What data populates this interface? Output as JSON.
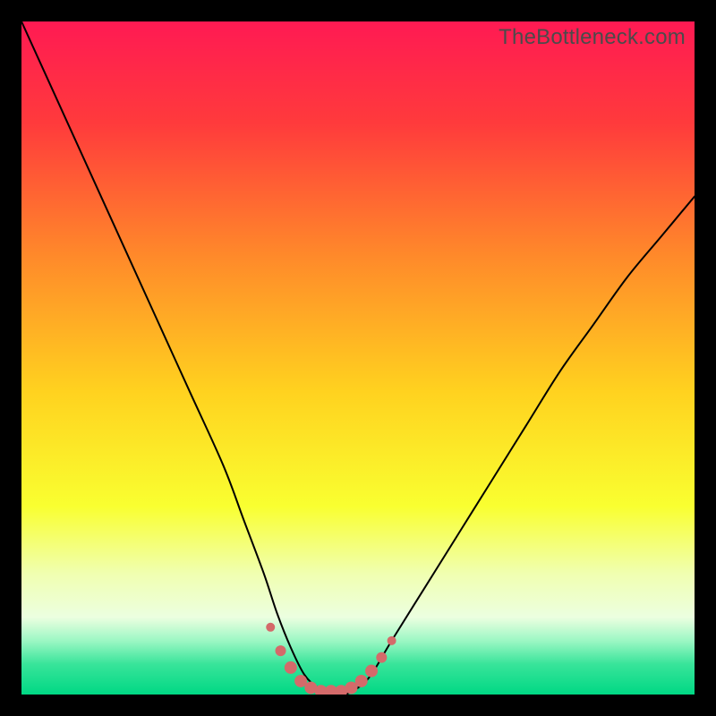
{
  "watermark": {
    "text": "TheBottleneck.com"
  },
  "chart_data": {
    "type": "line",
    "title": "",
    "xlabel": "",
    "ylabel": "",
    "xlim": [
      0,
      100
    ],
    "ylim": [
      0,
      100
    ],
    "background_gradient": {
      "stops": [
        {
          "offset": 0.0,
          "color": "#ff1a53"
        },
        {
          "offset": 0.15,
          "color": "#ff3a3c"
        },
        {
          "offset": 0.35,
          "color": "#ff8a2a"
        },
        {
          "offset": 0.55,
          "color": "#ffd21f"
        },
        {
          "offset": 0.72,
          "color": "#f9ff30"
        },
        {
          "offset": 0.82,
          "color": "#f0ffb0"
        },
        {
          "offset": 0.885,
          "color": "#ecffe0"
        },
        {
          "offset": 0.92,
          "color": "#9cf7c4"
        },
        {
          "offset": 0.955,
          "color": "#38e49a"
        },
        {
          "offset": 1.0,
          "color": "#00d884"
        }
      ]
    },
    "series": [
      {
        "name": "bottleneck-curve",
        "color": "#000000",
        "stroke_width": 2,
        "x": [
          0,
          5,
          10,
          15,
          20,
          25,
          30,
          33,
          36,
          38,
          40,
          42,
          44,
          46,
          48,
          50,
          52,
          55,
          60,
          65,
          70,
          75,
          80,
          85,
          90,
          95,
          100
        ],
        "y": [
          100,
          89,
          78,
          67,
          56,
          45,
          34,
          26,
          18,
          12,
          7,
          3,
          1,
          0,
          0,
          1,
          3,
          8,
          16,
          24,
          32,
          40,
          48,
          55,
          62,
          68,
          74
        ]
      }
    ],
    "valley_markers": {
      "name": "valley-markers",
      "color": "#d46a6a",
      "radius_small": 5,
      "radius_large": 7,
      "points": [
        {
          "x": 37.0,
          "y": 10.0,
          "r": 5
        },
        {
          "x": 38.5,
          "y": 6.5,
          "r": 6
        },
        {
          "x": 40.0,
          "y": 4.0,
          "r": 7
        },
        {
          "x": 41.5,
          "y": 2.0,
          "r": 7
        },
        {
          "x": 43.0,
          "y": 1.0,
          "r": 7
        },
        {
          "x": 44.5,
          "y": 0.5,
          "r": 7
        },
        {
          "x": 46.0,
          "y": 0.5,
          "r": 7
        },
        {
          "x": 47.5,
          "y": 0.5,
          "r": 7
        },
        {
          "x": 49.0,
          "y": 1.0,
          "r": 7
        },
        {
          "x": 50.5,
          "y": 2.0,
          "r": 7
        },
        {
          "x": 52.0,
          "y": 3.5,
          "r": 7
        },
        {
          "x": 53.5,
          "y": 5.5,
          "r": 6
        },
        {
          "x": 55.0,
          "y": 8.0,
          "r": 5
        }
      ]
    }
  }
}
